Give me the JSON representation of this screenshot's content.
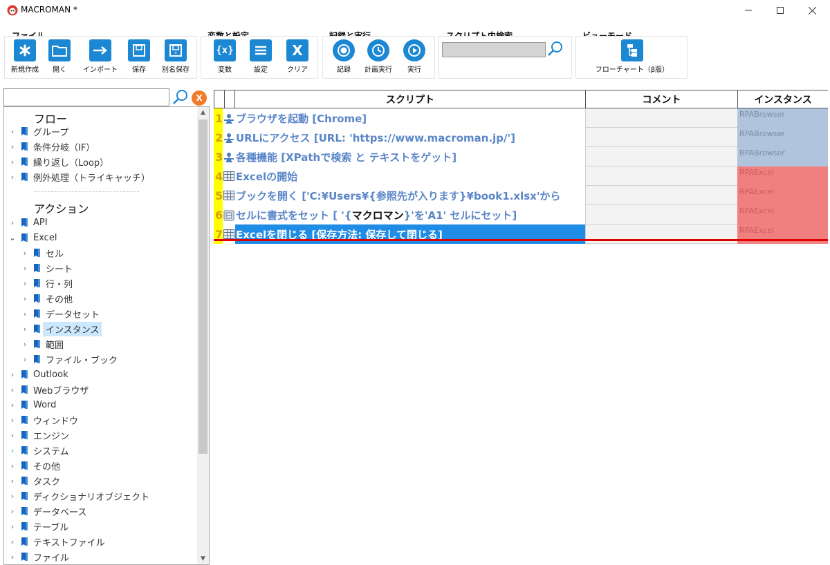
{
  "window": {
    "title": "MACROMAN *"
  },
  "ribbon": {
    "file": {
      "title": "ファイル",
      "buttons": [
        {
          "label": "新規作成",
          "icon": "asterisk-icon"
        },
        {
          "label": "開く",
          "icon": "folder-icon"
        },
        {
          "label": "インポート",
          "icon": "import-arrow-icon"
        },
        {
          "label": "保存",
          "icon": "save-icon"
        },
        {
          "label": "別名保存",
          "icon": "save-as-icon"
        }
      ]
    },
    "vars": {
      "title": "変数と設定",
      "buttons": [
        {
          "label": "変数",
          "icon": "variable-icon"
        },
        {
          "label": "設定",
          "icon": "menu-icon"
        },
        {
          "label": "クリア",
          "icon": "clear-x-icon"
        }
      ]
    },
    "record": {
      "title": "記録と実行",
      "buttons": [
        {
          "label": "記録",
          "icon": "record-icon"
        },
        {
          "label": "計画実行",
          "icon": "schedule-icon"
        },
        {
          "label": "実行",
          "icon": "play-icon"
        }
      ]
    },
    "search": {
      "title": "スクリプト内検索",
      "value": ""
    },
    "view": {
      "title": "ビューモード",
      "buttons": [
        {
          "label": "フローチャート（β版）",
          "icon": "flowchart-icon"
        }
      ]
    }
  },
  "tree": {
    "search_value": "",
    "clear_label": "X",
    "flow_heading": "フロー",
    "flow_items": [
      "グループ",
      "条件分岐（IF）",
      "繰り返し（Loop）",
      "例外処理（トライキャッチ）"
    ],
    "action_heading": "アクション",
    "action_items": [
      "API",
      "Excel",
      "セル",
      "シート",
      "行・列",
      "その他",
      "データセット",
      "インスタンス",
      "範囲",
      "ファイル・ブック",
      "Outlook",
      "Webブラウザ",
      "Word",
      "ウィンドウ",
      "エンジン",
      "システム",
      "その他",
      "タスク",
      "ディクショナリオブジェクト",
      "データベース",
      "テーブル",
      "テキストファイル",
      "ファイル"
    ]
  },
  "grid": {
    "headers": {
      "script": "スクリプト",
      "comment": "コメント",
      "instance": "インスタンス"
    },
    "rows": [
      {
        "num": "1",
        "icon": "browser-robot-icon",
        "script": "ブラウザを起動 [Chrome]",
        "comment": "",
        "instance": "RPABrowser"
      },
      {
        "num": "2",
        "icon": "browser-robot-icon",
        "script": "URLにアクセス [URL: 'https://www.macroman.jp/']",
        "comment": "",
        "instance": "RPABrowser"
      },
      {
        "num": "3",
        "icon": "browser-robot-icon",
        "script": "各種機能 [XPathで検索 と テキストをゲット]",
        "comment": "",
        "instance": "RPABrowser"
      },
      {
        "num": "4",
        "icon": "excel-grid-icon",
        "script": "Excelの開始",
        "comment": "",
        "instance": "RPAExcel"
      },
      {
        "num": "5",
        "icon": "excel-grid-icon",
        "script": "ブックを開く ['C:¥Users¥{参照先が入ります}¥book1.xlsx'から",
        "comment": "",
        "instance": "RPAExcel"
      },
      {
        "num": "6",
        "icon": "excel-cell-icon",
        "script_pre": "セルに書式をセット [ '{",
        "script_hl": "マクロマン",
        "script_post": "}'を'A1' セルにセット]",
        "comment": "",
        "instance": "RPAExcel"
      },
      {
        "num": "7",
        "icon": "excel-grid-icon",
        "script": "Excelを閉じる [保存方法: 保存して閉じる]",
        "comment": "",
        "instance": "RPAExcel"
      }
    ]
  }
}
